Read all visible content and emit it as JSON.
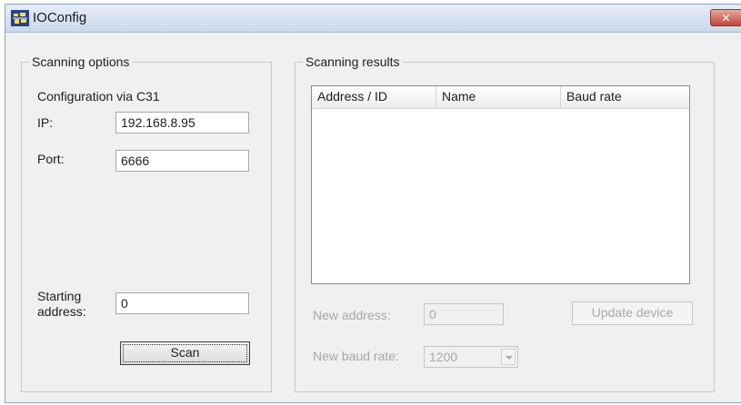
{
  "window": {
    "title": "IOConfig",
    "close_glyph": "✕"
  },
  "scanning_options": {
    "group_title": "Scanning options",
    "config_label": "Configuration via C31",
    "ip_label": "IP:",
    "ip_value": "192.168.8.95",
    "port_label": "Port:",
    "port_value": "6666",
    "starting_address_label_line1": "Starting",
    "starting_address_label_line2": "address:",
    "starting_address_value": "0",
    "scan_button": "Scan"
  },
  "scanning_results": {
    "group_title": "Scanning results",
    "columns": [
      "Address / ID",
      "Name",
      "Baud rate"
    ],
    "rows": [],
    "new_address_label": "New address:",
    "new_address_value": "0",
    "update_device_button": "Update device",
    "new_baud_rate_label": "New baud rate:",
    "new_baud_rate_value": "1200"
  },
  "colors": {
    "close_button": "#c0453a",
    "titlebar": "#c9d8ec",
    "disabled_text": "#a8a8a8"
  }
}
